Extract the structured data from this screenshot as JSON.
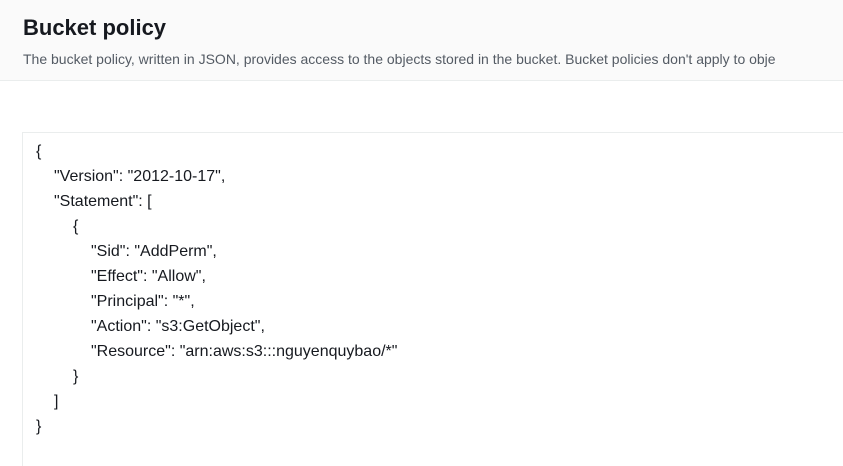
{
  "header": {
    "title": "Bucket policy",
    "description": "The bucket policy, written in JSON, provides access to the objects stored in the bucket. Bucket policies don't apply to obje"
  },
  "policy_editor": {
    "lines": [
      "{",
      "\"Version\": \"2012-10-17\",",
      "\"Statement\": [",
      "{",
      "\"Sid\": \"AddPerm\",",
      "\"Effect\": \"Allow\",",
      "\"Principal\": \"*\",",
      "\"Action\": \"s3:GetObject\",",
      "\"Resource\": \"arn:aws:s3:::nguyenquybao/*\"",
      "}",
      "]",
      "}"
    ]
  }
}
